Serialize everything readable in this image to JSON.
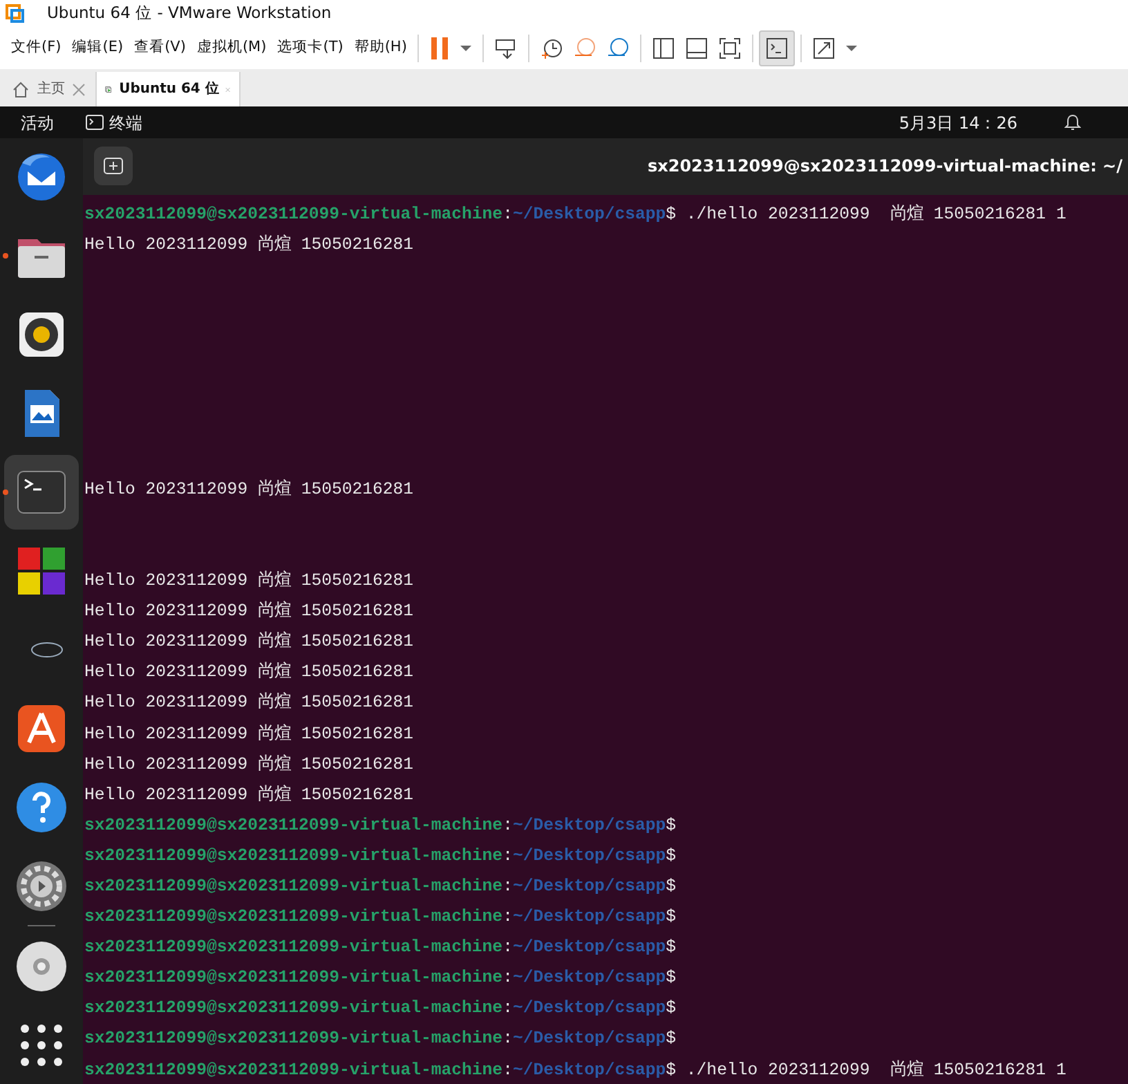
{
  "window": {
    "title": "Ubuntu 64 位 - VMware Workstation"
  },
  "menu": [
    "文件(F)",
    "编辑(E)",
    "查看(V)",
    "虚拟机(M)",
    "选项卡(T)",
    "帮助(H)"
  ],
  "tabs": [
    {
      "label": "主页",
      "selected": false
    },
    {
      "label": "Ubuntu 64 位",
      "selected": true
    }
  ],
  "top_bar": {
    "activities": "活动",
    "app": "终端",
    "clock": "5月3日 14：26"
  },
  "dock": [
    {
      "running": false,
      "selected": false
    },
    {
      "running": true,
      "selected": false
    },
    {
      "running": false,
      "selected": false
    },
    {
      "running": false,
      "selected": false
    },
    {
      "running": true,
      "selected": true
    },
    {
      "running": false,
      "selected": false
    },
    {
      "running": false,
      "selected": false
    },
    {
      "running": false,
      "selected": false
    },
    {
      "running": false,
      "selected": false
    },
    {
      "running": false,
      "selected": false
    },
    {
      "running": false,
      "selected": false
    },
    {
      "running": false,
      "selected": false
    }
  ],
  "terminal": {
    "title": "sx2023112099@sx2023112099-virtual-machine: ~/",
    "lines": [
      {
        "kind": "prompt",
        "user_host": "sx2023112099@sx2023112099-virtual-machine",
        "separator": ":",
        "path": "~/Desktop/csapp",
        "sign": "$",
        "command": " ./hello 2023112099  尚煊 15050216281 1"
      },
      {
        "kind": "output",
        "text": "Hello 2023112099 尚煊 15050216281"
      },
      {
        "kind": "blank"
      },
      {
        "kind": "blank"
      },
      {
        "kind": "blank"
      },
      {
        "kind": "blank"
      },
      {
        "kind": "blank"
      },
      {
        "kind": "blank"
      },
      {
        "kind": "blank"
      },
      {
        "kind": "output",
        "text": "Hello 2023112099 尚煊 15050216281"
      },
      {
        "kind": "blank"
      },
      {
        "kind": "blank"
      },
      {
        "kind": "output",
        "text": "Hello 2023112099 尚煊 15050216281"
      },
      {
        "kind": "output",
        "text": "Hello 2023112099 尚煊 15050216281"
      },
      {
        "kind": "output",
        "text": "Hello 2023112099 尚煊 15050216281"
      },
      {
        "kind": "output",
        "text": "Hello 2023112099 尚煊 15050216281"
      },
      {
        "kind": "output",
        "text": "Hello 2023112099 尚煊 15050216281"
      },
      {
        "kind": "output",
        "text": "Hello 2023112099 尚煊 15050216281"
      },
      {
        "kind": "output",
        "text": "Hello 2023112099 尚煊 15050216281"
      },
      {
        "kind": "output",
        "text": "Hello 2023112099 尚煊 15050216281"
      },
      {
        "kind": "prompt",
        "user_host": "sx2023112099@sx2023112099-virtual-machine",
        "separator": ":",
        "path": "~/Desktop/csapp",
        "sign": "$"
      },
      {
        "kind": "prompt",
        "user_host": "sx2023112099@sx2023112099-virtual-machine",
        "separator": ":",
        "path": "~/Desktop/csapp",
        "sign": "$"
      },
      {
        "kind": "prompt",
        "user_host": "sx2023112099@sx2023112099-virtual-machine",
        "separator": ":",
        "path": "~/Desktop/csapp",
        "sign": "$"
      },
      {
        "kind": "prompt",
        "user_host": "sx2023112099@sx2023112099-virtual-machine",
        "separator": ":",
        "path": "~/Desktop/csapp",
        "sign": "$"
      },
      {
        "kind": "prompt",
        "user_host": "sx2023112099@sx2023112099-virtual-machine",
        "separator": ":",
        "path": "~/Desktop/csapp",
        "sign": "$"
      },
      {
        "kind": "prompt",
        "user_host": "sx2023112099@sx2023112099-virtual-machine",
        "separator": ":",
        "path": "~/Desktop/csapp",
        "sign": "$"
      },
      {
        "kind": "prompt",
        "user_host": "sx2023112099@sx2023112099-virtual-machine",
        "separator": ":",
        "path": "~/Desktop/csapp",
        "sign": "$"
      },
      {
        "kind": "prompt",
        "user_host": "sx2023112099@sx2023112099-virtual-machine",
        "separator": ":",
        "path": "~/Desktop/csapp",
        "sign": "$"
      },
      {
        "kind": "prompt",
        "user_host": "sx2023112099@sx2023112099-virtual-machine",
        "separator": ":",
        "path": "~/Desktop/csapp",
        "sign": "$",
        "command": " ./hello 2023112099  尚煊 15050216281 1"
      }
    ]
  }
}
